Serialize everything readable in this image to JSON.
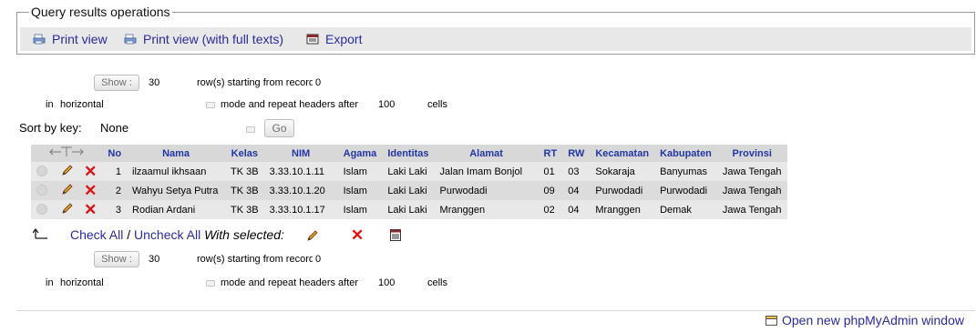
{
  "operations": {
    "legend": "Query results operations",
    "print_view": "Print view",
    "print_full": "Print view (with full texts)",
    "export": "Export"
  },
  "nav_top": {
    "show_label": "Show :",
    "rows_value": "30",
    "starting_label": "row(s) starting from record #",
    "record_value": "0",
    "in_label": "in",
    "mode_value": "horizontal",
    "mode_label": "mode and repeat headers after",
    "repeat_value": "100",
    "cells_label": "cells"
  },
  "sort": {
    "label": "Sort by key:",
    "value": "None",
    "go_label": "Go"
  },
  "table": {
    "columns": [
      "No",
      "Nama",
      "Kelas",
      "NIM",
      "Agama",
      "Identitas",
      "Alamat",
      "RT",
      "RW",
      "Kecamatan",
      "Kabupaten",
      "Provinsi"
    ],
    "rows": [
      {
        "no": "1",
        "nama": "ilzaamul ikhsaan",
        "kelas": "TK 3B",
        "nim": "3.33.10.1.11",
        "agama": "Islam",
        "identitas": "Laki Laki",
        "alamat": "Jalan Imam Bonjol",
        "rt": "01",
        "rw": "03",
        "kecamatan": "Sokaraja",
        "kabupaten": "Banyumas",
        "provinsi": "Jawa Tengah"
      },
      {
        "no": "2",
        "nama": "Wahyu Setya Putra",
        "kelas": "TK 3B",
        "nim": "3.33.10.1.20",
        "agama": "Islam",
        "identitas": "Laki Laki",
        "alamat": "Purwodadi",
        "rt": "09",
        "rw": "04",
        "kecamatan": "Purwodadi",
        "kabupaten": "Purwodadi",
        "provinsi": "Jawa Tengah"
      },
      {
        "no": "3",
        "nama": "Rodian Ardani",
        "kelas": "TK 3B",
        "nim": "3.33.10.1.17",
        "agama": "Islam",
        "identitas": "Laki Laki",
        "alamat": "Mranggen",
        "rt": "02",
        "rw": "04",
        "kecamatan": "Mranggen",
        "kabupaten": "Demak",
        "provinsi": "Jawa Tengah"
      }
    ]
  },
  "bulk": {
    "check_all": "Check All",
    "separator": " / ",
    "uncheck_all": "Uncheck All",
    "with_selected": "With selected:"
  },
  "nav_bottom": {
    "show_label": "Show :",
    "rows_value": "30",
    "starting_label": "row(s) starting from record #",
    "record_value": "0",
    "in_label": "in",
    "mode_value": "horizontal",
    "mode_label": "mode and repeat headers after",
    "repeat_value": "100",
    "cells_label": "cells"
  },
  "footer": {
    "open_window": "Open new phpMyAdmin window"
  },
  "colors": {
    "link": "#2a2aa0",
    "header_text": "#2236a8",
    "delete_red": "#dd1111"
  }
}
